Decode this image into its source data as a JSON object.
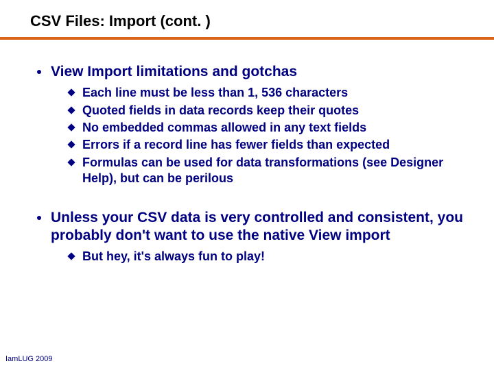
{
  "title": "CSV Files: Import (cont. )",
  "bullets": {
    "b1": {
      "head": "View Import limitations and gotchas",
      "subs": [
        "Each line must be less than 1, 536 characters",
        "Quoted fields in data records keep their quotes",
        "No embedded commas allowed in any text fields",
        "Errors if a record line has fewer fields than expected",
        "Formulas can be used for data transformations (see Designer Help), but can be perilous"
      ]
    },
    "b2": {
      "head": "Unless your CSV data is very controlled and consistent, you probably don't want to use the native View import",
      "subs": [
        "But hey, it's always fun to play!"
      ]
    }
  },
  "footer": "IamLUG 2009"
}
